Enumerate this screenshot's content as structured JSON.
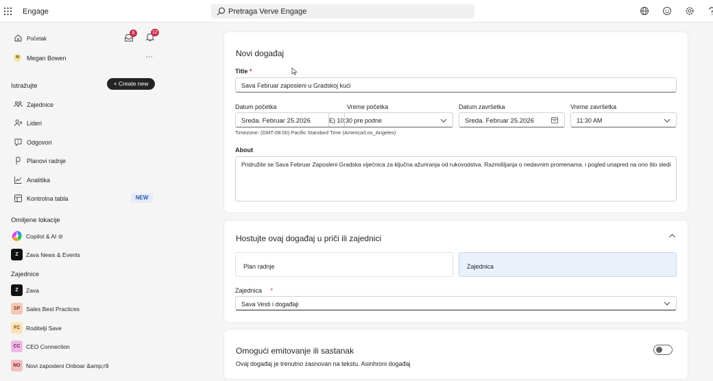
{
  "app": {
    "name": "Engage"
  },
  "search": {
    "placeholder": "Pretraga Verve Engage"
  },
  "sidebar": {
    "home_label": "Početak",
    "inbox_badge": "6",
    "bell_badge": "12",
    "user_name": "Megan Bowen",
    "user_initial": "M",
    "more_label": "···",
    "explore_title": "Istražujte",
    "create_label": "+ Create new",
    "nav": [
      {
        "label": "Zajednice"
      },
      {
        "label": "Lideri"
      },
      {
        "label": "Odgovori"
      },
      {
        "label": "Planovi radnje"
      },
      {
        "label": "Analitika"
      },
      {
        "label": "Kontrolna tabla"
      }
    ],
    "new_tag": "NEW",
    "favorites_title": "Omiljene lokacije",
    "favorites": [
      {
        "label": "Copilot & AI ⊘"
      },
      {
        "label": "Zava News & Events",
        "initial": "Z"
      }
    ],
    "communities_title": "Zajednice",
    "communities": [
      {
        "label": "Zava",
        "initial": "Z",
        "bg": "#111111",
        "fg": "#ffffff"
      },
      {
        "label": "Sales Best Practices",
        "initial": "SP",
        "bg": "#f4c7b6",
        "fg": "#7a3b25"
      },
      {
        "label": "Roditelji Save",
        "initial": "PZ",
        "bg": "#fbe3b8",
        "fg": "#7a5410"
      },
      {
        "label": "CEO Connection",
        "initial": "CC",
        "bg": "#f0b8e4",
        "fg": "#6b1d5b"
      },
      {
        "label": "Novi zaposleni Onboar &amp;r9",
        "initial": "NO",
        "bg": "#f2c0c0",
        "fg": "#7a2020"
      }
    ]
  },
  "event": {
    "heading": "Novi događaj",
    "title_label": "Title",
    "required_mark": "*",
    "title_value": "Sava Februar zaposleni u Gradskoj kući",
    "start_date_label": "Datum početka",
    "start_date_value": "Sreda. Februar 25.2026",
    "start_time_label": "Vreme početka",
    "start_time_value": "E) 10:30 pre podne",
    "end_date_label": "Datum završetka",
    "end_date_value": "Sreda. Februar 25.2026",
    "end_time_label": "Vreme završetka",
    "end_time_value": "11:30 AM",
    "timezone": "Timezone: (GMT-08:00) Pacific Standard Time (America/Los_Angeles)",
    "about_label": "About",
    "about_value": "Pridružite se Sava Februar Zaposleni Gradska vijećnica za ključna ažuriranja od rukovodstva. Razmišljanja o nedavnim promenama. i pogled unapred na ono što sledi"
  },
  "host": {
    "heading": "Hostujte ovaj događaj u priči ili zajednici",
    "option_plan": "Plan radnje",
    "option_community": "Zajednica",
    "community_label": "Zajednica",
    "community_value": "Sava Vesti i događaji"
  },
  "broadcast": {
    "heading": "Omogući emitovanje ili sastanak",
    "description": "Ovaj događaj je trenutno zasnovan na tekstu. Asinhroni događaj"
  },
  "colors": {
    "accent": "#c4314b",
    "selected_option": "#eaf1fb"
  }
}
